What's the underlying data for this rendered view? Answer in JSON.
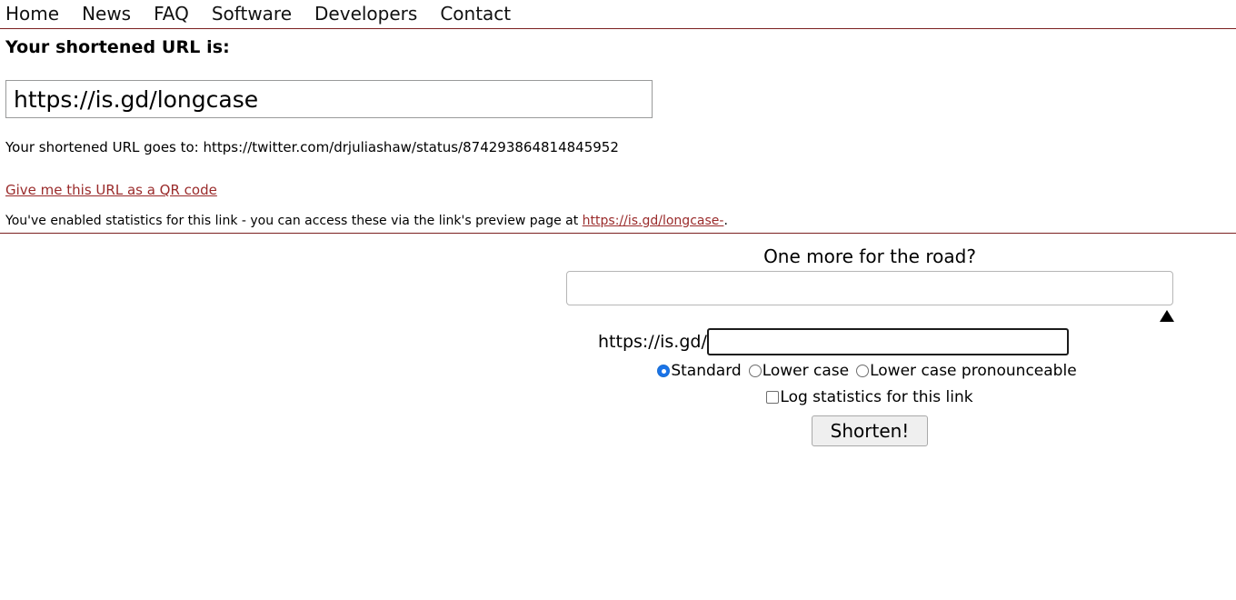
{
  "nav": {
    "items": [
      {
        "label": "Home"
      },
      {
        "label": "News"
      },
      {
        "label": "FAQ"
      },
      {
        "label": "Software"
      },
      {
        "label": "Developers"
      },
      {
        "label": "Contact"
      }
    ]
  },
  "result": {
    "heading": "Your shortened URL is:",
    "short_url_value": "https://is.gd/longcase",
    "destination_text": "Your shortened URL goes to: https://twitter.com/drjuliashaw/status/874293864814845952",
    "qr_link_label": "Give me this URL as a QR code",
    "stats_note_prefix": "You've enabled statistics for this link - you can access these via the link's preview page at ",
    "stats_note_link": "https://is.gd/longcase-",
    "stats_note_suffix": "."
  },
  "more_form": {
    "title": "One more for the road?",
    "long_url_value": "",
    "long_url_placeholder": "",
    "slug_prefix": "https://is.gd/",
    "slug_value": "",
    "slug_placeholder": "",
    "radio_options": [
      {
        "label": "Standard",
        "checked": true
      },
      {
        "label": "Lower case",
        "checked": false
      },
      {
        "label": "Lower case pronounceable",
        "checked": false
      }
    ],
    "checkbox": {
      "label": "Log statistics for this link",
      "checked": false
    },
    "submit_label": "Shorten!",
    "caret_icon": "triangle-up-icon"
  },
  "colors": {
    "rule": "#7b2020",
    "link": "#9a2b2b",
    "radio_accent": "#1a73e8",
    "button_bg": "#efefef"
  }
}
